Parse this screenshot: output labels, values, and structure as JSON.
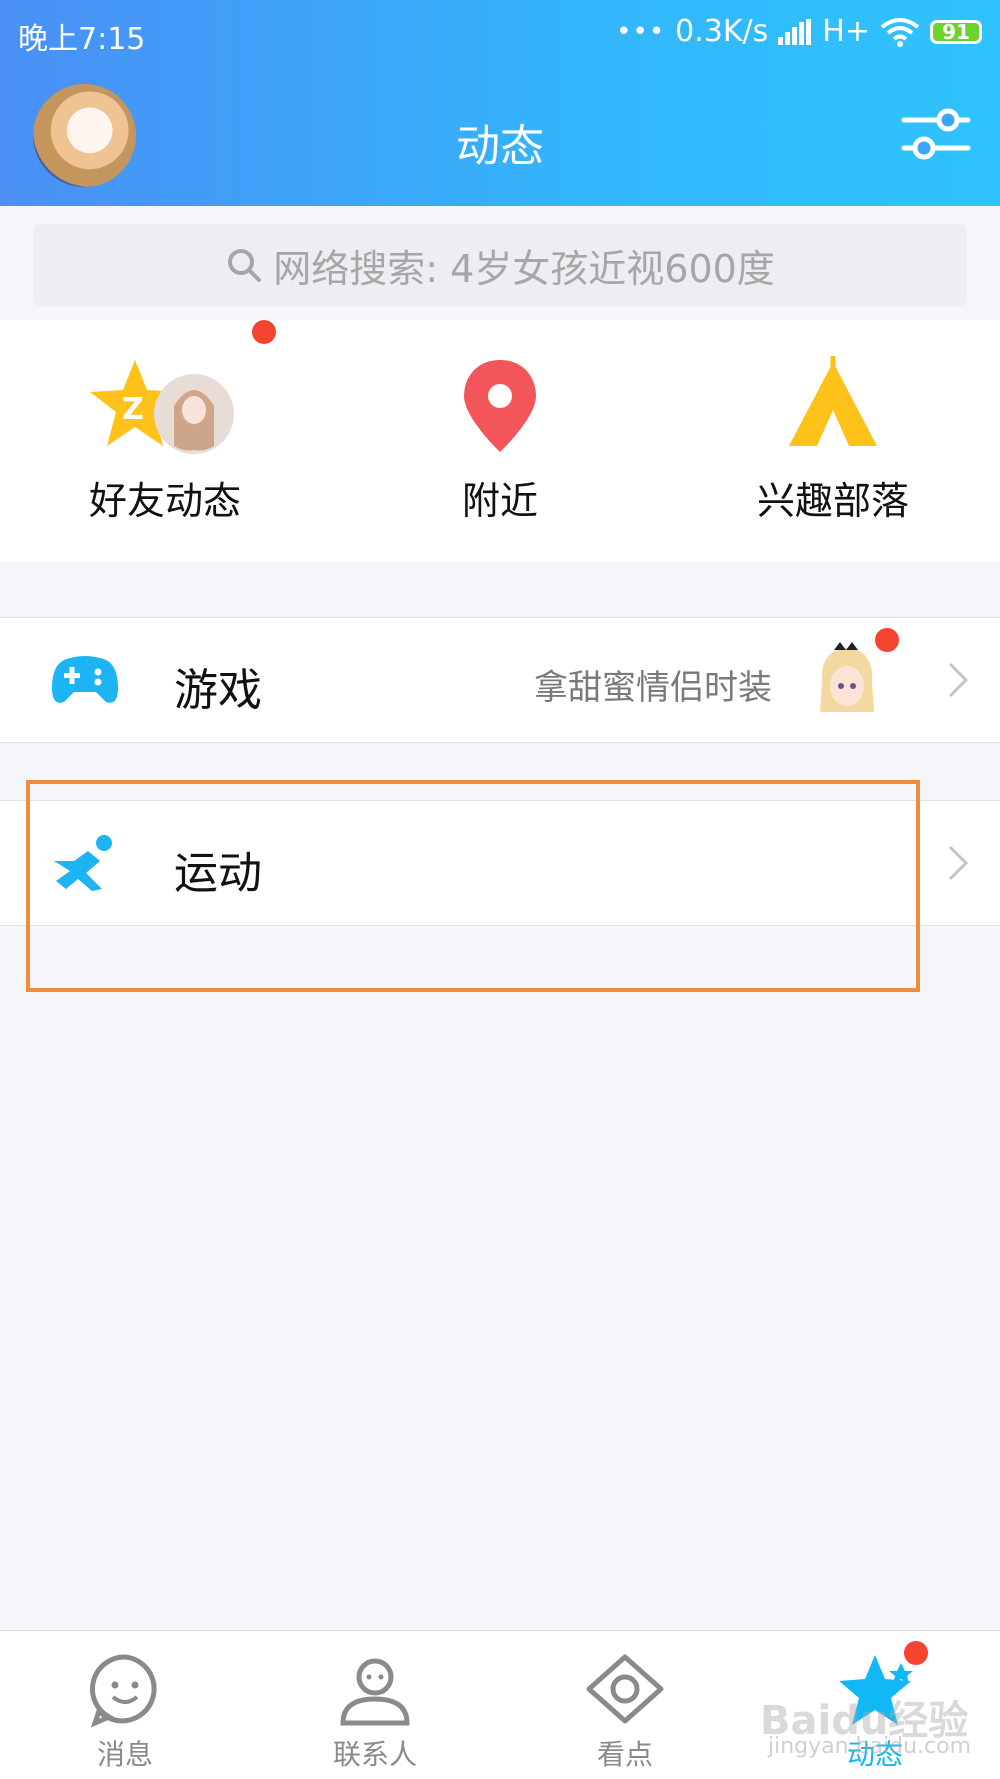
{
  "status_bar": {
    "time": "晚上7:15",
    "dots": "•••",
    "net_speed": "0.3K/s",
    "network": "H+",
    "battery": "91"
  },
  "header": {
    "title": "动态",
    "avatar": "user-avatar",
    "filter_icon": "sliders-icon"
  },
  "search": {
    "placeholder": "网络搜索: 4岁女孩近视600度"
  },
  "quick_entries": [
    {
      "label": "好友动态",
      "icon": "qzone-star-icon",
      "badge": true
    },
    {
      "label": "附近",
      "icon": "location-pin-icon"
    },
    {
      "label": "兴趣部落",
      "icon": "tent-icon"
    }
  ],
  "rows": [
    {
      "title": "游戏",
      "subtitle": "拿甜蜜情侣时装",
      "icon": "gamepad-icon",
      "badge": true
    },
    {
      "title": "运动",
      "icon": "running-icon"
    }
  ],
  "tabs": [
    {
      "label": "消息",
      "icon": "chat-smile-icon"
    },
    {
      "label": "联系人",
      "icon": "contact-person-icon"
    },
    {
      "label": "看点",
      "icon": "eye-icon"
    },
    {
      "label": "动态",
      "icon": "star-icon",
      "active": true
    }
  ],
  "watermark": {
    "line1": "Baidu经验",
    "line2": "jingyan.baidu.com"
  },
  "colors": {
    "accent": "#12b7f5",
    "badge": "#f5442f",
    "highlight": "#f28c3a"
  }
}
